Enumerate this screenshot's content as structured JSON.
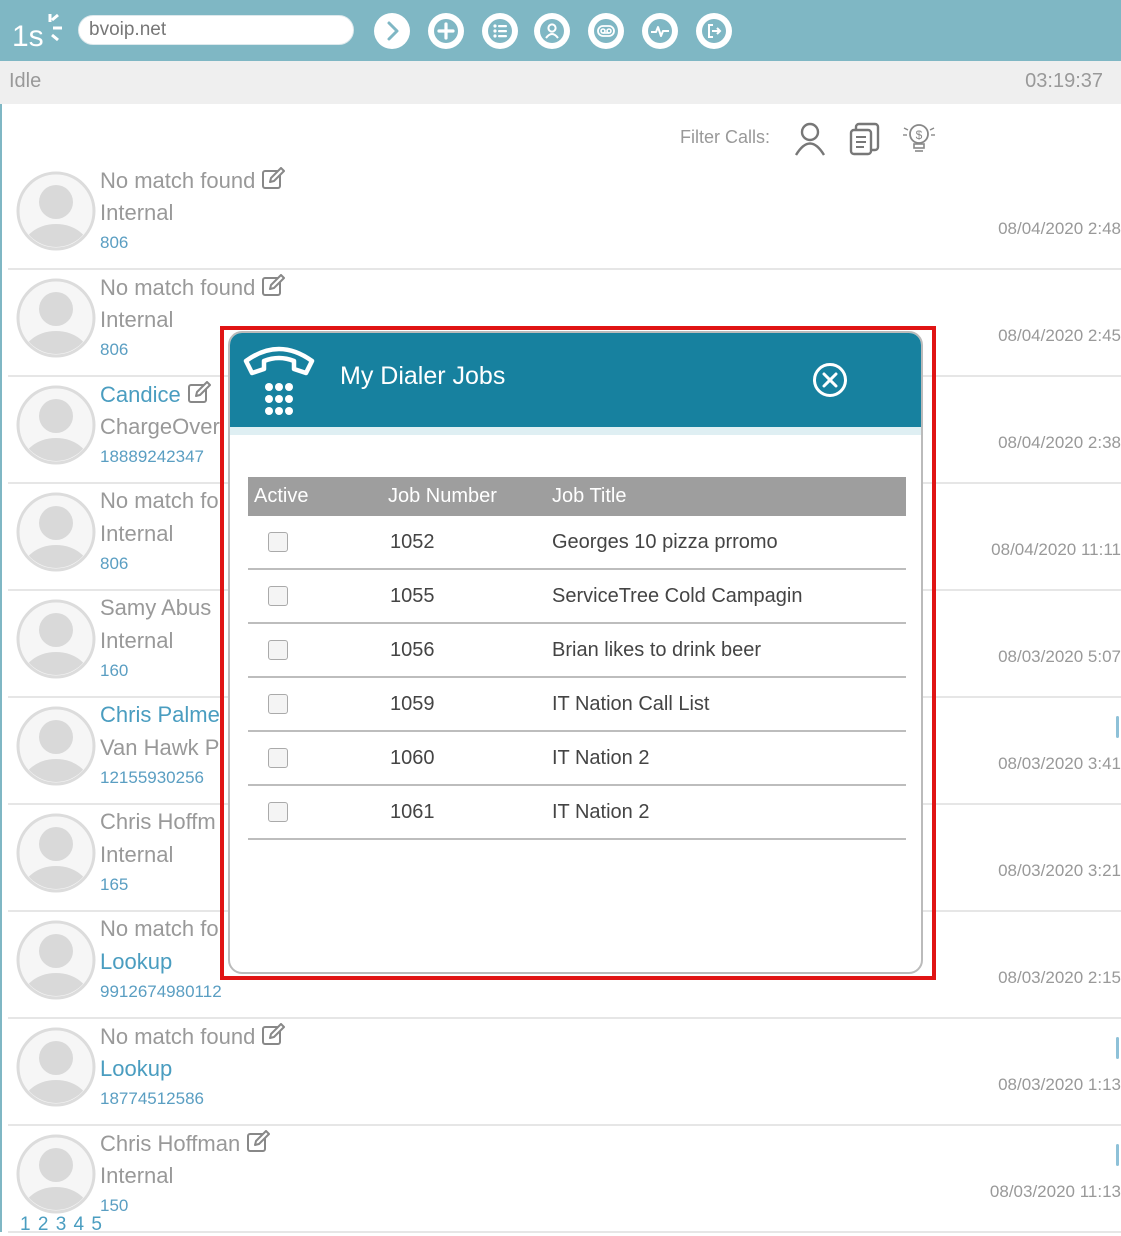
{
  "app": {
    "search_value": "bvoip.net",
    "status": "Idle",
    "clock": "03:19:37",
    "filter_label": "Filter Calls:",
    "accent": "#17819f",
    "toolbar_color": "#7fb7c4"
  },
  "toolbar_icons": [
    "chevron-right-icon",
    "plus-icon",
    "list-icon",
    "user-icon",
    "voicemail-icon",
    "activity-icon",
    "logout-icon"
  ],
  "calls": [
    {
      "name": "No match found",
      "company": "Internal",
      "ext": "806",
      "date": "08/04/2020 2:48"
    },
    {
      "name": "No match found",
      "company": "Internal",
      "ext": "806",
      "date": "08/04/2020 2:45"
    },
    {
      "name": "Candice",
      "company": "ChargeOver",
      "ext": "18889242347",
      "date": "08/04/2020 2:38"
    },
    {
      "name": "No match fo",
      "company": "Internal",
      "ext": "806",
      "date": "08/04/2020 11:11"
    },
    {
      "name": "Samy Abus",
      "company": "Internal",
      "ext": "160",
      "date": "08/03/2020 5:07"
    },
    {
      "name": "Chris Palme",
      "company": "Van Hawk P",
      "ext": "12155930256",
      "date": "08/03/2020 3:41"
    },
    {
      "name": "Chris Hoffm",
      "company": "Internal",
      "ext": "165",
      "date": "08/03/2020 3:21"
    },
    {
      "name": "No match fo",
      "company": "Lookup",
      "ext": "9912674980112",
      "date": "08/03/2020 2:15"
    },
    {
      "name": "No match found",
      "company": "Lookup",
      "ext": "18774512586",
      "date": "08/03/2020 1:13"
    },
    {
      "name": "Chris Hoffman",
      "company": "Internal",
      "ext": "150",
      "date": "08/03/2020 11:13"
    }
  ],
  "pager": "1 2 3 4 5",
  "dialog": {
    "title": "My Dialer Jobs",
    "columns": [
      "Active",
      "Job Number",
      "Job Title"
    ],
    "jobs": [
      {
        "number": "1052",
        "title": "Georges 10 pizza prromo",
        "active": false
      },
      {
        "number": "1055",
        "title": "ServiceTree Cold Campagin",
        "active": false
      },
      {
        "number": "1056",
        "title": "Brian likes to drink beer",
        "active": false
      },
      {
        "number": "1059",
        "title": "IT Nation Call List",
        "active": false
      },
      {
        "number": "1060",
        "title": "IT Nation 2",
        "active": false
      },
      {
        "number": "1061",
        "title": "IT Nation 2",
        "active": false
      }
    ]
  }
}
